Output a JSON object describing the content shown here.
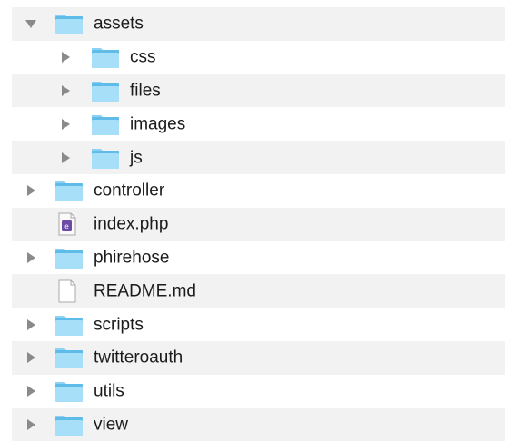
{
  "colors": {
    "folder_tab": "#8fd1f4",
    "folder_body": "#5fbce9",
    "folder_front": "#a7def8",
    "stripe": "#f2f2f2",
    "disclosure": "#8a8a8a"
  },
  "tree": {
    "items": [
      {
        "label": "assets",
        "kind": "folder",
        "expanded": true,
        "level": 0
      },
      {
        "label": "css",
        "kind": "folder",
        "expanded": false,
        "level": 1
      },
      {
        "label": "files",
        "kind": "folder",
        "expanded": false,
        "level": 1
      },
      {
        "label": "images",
        "kind": "folder",
        "expanded": false,
        "level": 1
      },
      {
        "label": "js",
        "kind": "folder",
        "expanded": false,
        "level": 1
      },
      {
        "label": "controller",
        "kind": "folder",
        "expanded": false,
        "level": 0
      },
      {
        "label": "index.php",
        "kind": "php-file",
        "level": 0
      },
      {
        "label": "phirehose",
        "kind": "folder",
        "expanded": false,
        "level": 0
      },
      {
        "label": "README.md",
        "kind": "text-file",
        "level": 0
      },
      {
        "label": "scripts",
        "kind": "folder",
        "expanded": false,
        "level": 0
      },
      {
        "label": "twitteroauth",
        "kind": "folder",
        "expanded": false,
        "level": 0
      },
      {
        "label": "utils",
        "kind": "folder",
        "expanded": false,
        "level": 0
      },
      {
        "label": "view",
        "kind": "folder",
        "expanded": false,
        "level": 0
      }
    ]
  }
}
